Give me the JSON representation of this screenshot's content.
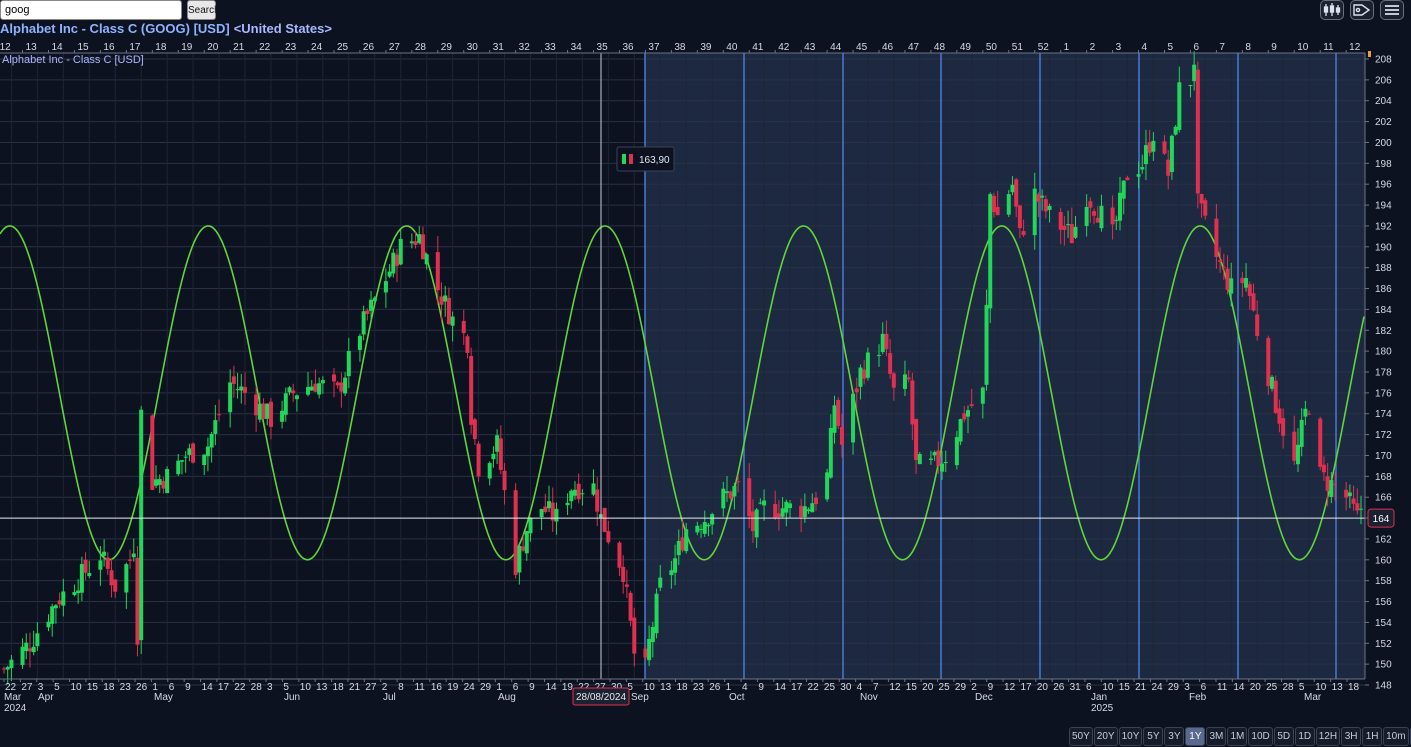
{
  "search": {
    "value": "goog",
    "button_label": "Search"
  },
  "header": {
    "title": "Alphabet Inc - Class C (GOOG) [USD]",
    "country": "<United States>"
  },
  "chart_label": "Alphabet Inc - Class C [USD]",
  "toolbar": {
    "icons": [
      "chart-settings-icon",
      "tag-icon",
      "menu-icon"
    ]
  },
  "tooltip": {
    "value": "163,90"
  },
  "crosshair": {
    "date_label": "28/08/2024",
    "price_label": "164"
  },
  "timeframes": {
    "items": [
      "50Y",
      "20Y",
      "10Y",
      "5Y",
      "3Y",
      "1Y",
      "3M",
      "1M",
      "10D",
      "5D",
      "1D",
      "12H",
      "3H",
      "1H",
      "10m",
      "1m"
    ],
    "active": "1Y"
  },
  "colors": {
    "up": "#22d65a",
    "down": "#e03050",
    "cycle": "#5fd63a",
    "cycle_marker": "#4a7ad6",
    "background": "#0d1220",
    "shaded": "#1d2940"
  },
  "chart_data": {
    "type": "candlestick",
    "symbol": "GOOG",
    "currency": "USD",
    "y_axis": {
      "min": 148,
      "max": 208,
      "step": 2,
      "ticks": [
        148,
        150,
        152,
        154,
        156,
        158,
        160,
        162,
        164,
        166,
        168,
        170,
        172,
        174,
        176,
        178,
        180,
        182,
        184,
        186,
        188,
        190,
        192,
        194,
        196,
        198,
        200,
        202,
        204,
        206,
        208
      ]
    },
    "week_numbers": [
      "12",
      "13",
      "14",
      "15",
      "16",
      "17",
      "18",
      "19",
      "20",
      "21",
      "22",
      "23",
      "24",
      "25",
      "26",
      "27",
      "28",
      "29",
      "30",
      "31",
      "32",
      "33",
      "34",
      "35",
      "36",
      "37",
      "38",
      "39",
      "40",
      "41",
      "42",
      "43",
      "44",
      "45",
      "46",
      "47",
      "48",
      "49",
      "50",
      "51",
      "52",
      "1",
      "2",
      "3",
      "4",
      "5",
      "6",
      "7",
      "8",
      "9",
      "10",
      "11",
      "12"
    ],
    "day_labels": [
      "22",
      "27",
      "3",
      "5",
      "10",
      "15",
      "18",
      "23",
      "26",
      "1",
      "6",
      "9",
      "14",
      "17",
      "22",
      "28",
      "3",
      "5",
      "10",
      "13",
      "18",
      "21",
      "27",
      "2",
      "8",
      "11",
      "16",
      "19",
      "24",
      "29",
      "1",
      "6",
      "9",
      "14",
      "19",
      "22",
      "27",
      "30",
      "5",
      "10",
      "13",
      "18",
      "23",
      "26",
      "1",
      "4",
      "9",
      "14",
      "17",
      "22",
      "25",
      "30",
      "4",
      "7",
      "12",
      "15",
      "20",
      "25",
      "29",
      "2",
      "9",
      "12",
      "17",
      "20",
      "26",
      "31",
      "6",
      "10",
      "15",
      "21",
      "24",
      "29",
      "3",
      "6",
      "11",
      "14",
      "20",
      "25",
      "28",
      "5",
      "10",
      "13",
      "18"
    ],
    "month_labels": [
      {
        "text": "Mar",
        "sub": "2024"
      },
      {
        "text": "Apr"
      },
      {
        "text": "May"
      },
      {
        "text": "Jun"
      },
      {
        "text": "Jul"
      },
      {
        "text": "Aug"
      },
      {
        "text": "Sep"
      },
      {
        "text": "Oct"
      },
      {
        "text": "Nov"
      },
      {
        "text": "Dec"
      },
      {
        "text": "Jan",
        "sub": "2025"
      },
      {
        "text": "Feb"
      },
      {
        "text": "Mar"
      }
    ],
    "cycle_sine": {
      "center": 176,
      "amplitude": 16,
      "period_days": 70
    },
    "horizontal_line": 164,
    "anchors": [
      [
        "2024-03-20",
        149.5
      ],
      [
        "2024-03-27",
        152
      ],
      [
        "2024-04-03",
        156
      ],
      [
        "2024-04-10",
        158.5
      ],
      [
        "2024-04-15",
        160.5
      ],
      [
        "2024-04-19",
        157.5
      ],
      [
        "2024-04-23",
        160
      ],
      [
        "2024-04-24",
        161.5
      ],
      [
        "2024-04-25",
        153
      ],
      [
        "2024-04-26",
        174
      ],
      [
        "2024-04-29",
        167.5
      ],
      [
        "2024-05-03",
        168
      ],
      [
        "2024-05-08",
        170
      ],
      [
        "2024-05-14",
        171
      ],
      [
        "2024-05-20",
        177
      ],
      [
        "2024-05-24",
        176
      ],
      [
        "2024-05-31",
        173.5
      ],
      [
        "2024-06-06",
        176
      ],
      [
        "2024-06-12",
        177
      ],
      [
        "2024-06-18",
        176
      ],
      [
        "2024-06-24",
        182
      ],
      [
        "2024-07-01",
        187
      ],
      [
        "2024-07-05",
        190
      ],
      [
        "2024-07-10",
        191
      ],
      [
        "2024-07-15",
        186
      ],
      [
        "2024-07-19",
        183
      ],
      [
        "2024-07-23",
        181
      ],
      [
        "2024-07-24",
        174
      ],
      [
        "2024-07-26",
        169
      ],
      [
        "2024-07-31",
        171
      ],
      [
        "2024-08-05",
        159.5
      ],
      [
        "2024-08-08",
        163
      ],
      [
        "2024-08-12",
        165
      ],
      [
        "2024-08-16",
        164
      ],
      [
        "2024-08-20",
        167
      ],
      [
        "2024-08-26",
        167
      ],
      [
        "2024-08-28",
        164
      ],
      [
        "2024-09-03",
        159
      ],
      [
        "2024-09-06",
        151
      ],
      [
        "2024-09-09",
        149.5
      ],
      [
        "2024-09-10",
        152
      ],
      [
        "2024-09-13",
        157.5
      ],
      [
        "2024-09-17",
        160
      ],
      [
        "2024-09-20",
        163
      ],
      [
        "2024-09-25",
        164
      ],
      [
        "2024-09-30",
        166
      ],
      [
        "2024-10-04",
        167
      ],
      [
        "2024-10-08",
        163
      ],
      [
        "2024-10-11",
        165
      ],
      [
        "2024-10-17",
        165
      ],
      [
        "2024-10-22",
        165
      ],
      [
        "2024-10-25",
        166
      ],
      [
        "2024-10-28",
        168
      ],
      [
        "2024-10-30",
        175
      ],
      [
        "2024-11-01",
        171
      ],
      [
        "2024-11-06",
        178
      ],
      [
        "2024-11-08",
        179
      ],
      [
        "2024-11-12",
        181
      ],
      [
        "2024-11-15",
        176
      ],
      [
        "2024-11-19",
        177
      ],
      [
        "2024-11-21",
        169
      ],
      [
        "2024-11-25",
        169
      ],
      [
        "2024-11-29",
        170
      ],
      [
        "2024-12-04",
        174
      ],
      [
        "2024-12-09",
        176
      ],
      [
        "2024-12-10",
        184
      ],
      [
        "2024-12-11",
        195
      ],
      [
        "2024-12-13",
        193
      ],
      [
        "2024-12-17",
        196
      ],
      [
        "2024-12-19",
        191
      ],
      [
        "2024-12-23",
        195
      ],
      [
        "2024-12-27",
        193
      ],
      [
        "2025-01-02",
        191
      ],
      [
        "2025-01-06",
        195
      ],
      [
        "2025-01-10",
        193
      ],
      [
        "2025-01-13",
        191
      ],
      [
        "2025-01-17",
        197
      ],
      [
        "2025-01-21",
        198
      ],
      [
        "2025-01-24",
        201
      ],
      [
        "2025-01-28",
        197
      ],
      [
        "2025-01-31",
        205
      ],
      [
        "2025-02-03",
        206
      ],
      [
        "2025-02-04",
        208
      ],
      [
        "2025-02-05",
        194
      ],
      [
        "2025-02-10",
        189
      ],
      [
        "2025-02-14",
        186
      ],
      [
        "2025-02-18",
        187
      ],
      [
        "2025-02-21",
        182
      ],
      [
        "2025-02-26",
        175
      ],
      [
        "2025-03-03",
        169
      ],
      [
        "2025-03-06",
        174
      ],
      [
        "2025-03-07",
        175
      ],
      [
        "2025-03-10",
        168
      ],
      [
        "2025-03-14",
        167
      ],
      [
        "2025-03-17",
        166
      ],
      [
        "2025-03-20",
        164
      ],
      [
        "2025-03-21",
        165
      ]
    ]
  }
}
